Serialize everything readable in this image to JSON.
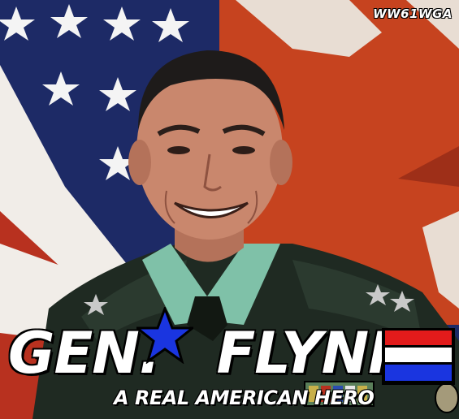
{
  "watermark": "WW61WGA",
  "title": {
    "part1": "GEN.",
    "part2": "FLYNN"
  },
  "subtitle": "A REAL AMERICAN HERO",
  "colors": {
    "flag_blue": "#1d2a66",
    "flag_red": "#b8311f",
    "flag_white": "#f1ede8",
    "army_flag_red": "#c6431f",
    "uniform": "#1f2a22",
    "shirt": "#7fc1a8",
    "skin": "#c9876d",
    "accent_blue": "#1a35e0",
    "accent_red": "#e21b1b"
  },
  "icons": [
    "star-icon",
    "flag-stripes-icon"
  ]
}
